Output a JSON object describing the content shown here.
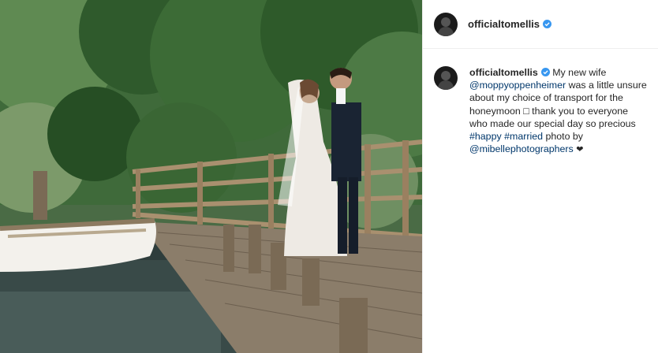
{
  "post": {
    "username": "officialtomellis",
    "verified": true
  },
  "caption": {
    "username": "officialtomellis",
    "text_1": "My new wife",
    "mention_1": "@moppyoppenheimer",
    "text_2": "was a little unsure about my choice of transport for the honeymoon",
    "emoji_1": "□",
    "text_3": "thank you to everyone who made our special day so precious",
    "hashtag_1": "#happy",
    "hashtag_2": "#married",
    "text_4": "photo by",
    "mention_2": "@mibellephotographers",
    "emoji_2": "❤"
  },
  "colors": {
    "verified_blue": "#3897f0",
    "link": "#00376b",
    "border": "#efefef"
  },
  "icons": {
    "verified": "verified-badge-icon"
  }
}
